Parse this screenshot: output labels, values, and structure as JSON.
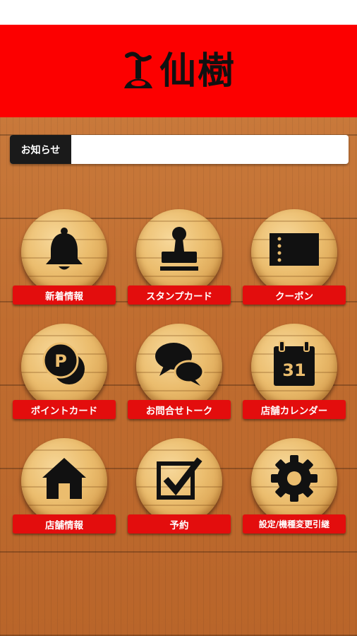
{
  "header": {
    "logo_text": "仙樹",
    "background": "#fc0000"
  },
  "notice": {
    "label": "お知らせ",
    "text": ""
  },
  "menu": {
    "items": [
      {
        "label": "新着情報",
        "icon": "bell-icon"
      },
      {
        "label": "スタンプカード",
        "icon": "stamp-icon"
      },
      {
        "label": "クーポン",
        "icon": "ticket-icon"
      },
      {
        "label": "ポイントカード",
        "icon": "points-coin-icon"
      },
      {
        "label": "お問合せトーク",
        "icon": "chat-bubbles-icon"
      },
      {
        "label": "店舗カレンダー",
        "icon": "calendar-icon"
      },
      {
        "label": "店舗情報",
        "icon": "house-icon"
      },
      {
        "label": "予約",
        "icon": "checkbox-icon"
      },
      {
        "label": "設定/機種変更引継",
        "icon": "gear-icon"
      }
    ],
    "calendar_day": "31",
    "points_letter": "P"
  },
  "colors": {
    "accent_red": "#e30d0d",
    "wood": "#c06d30",
    "icon": "#111111"
  }
}
